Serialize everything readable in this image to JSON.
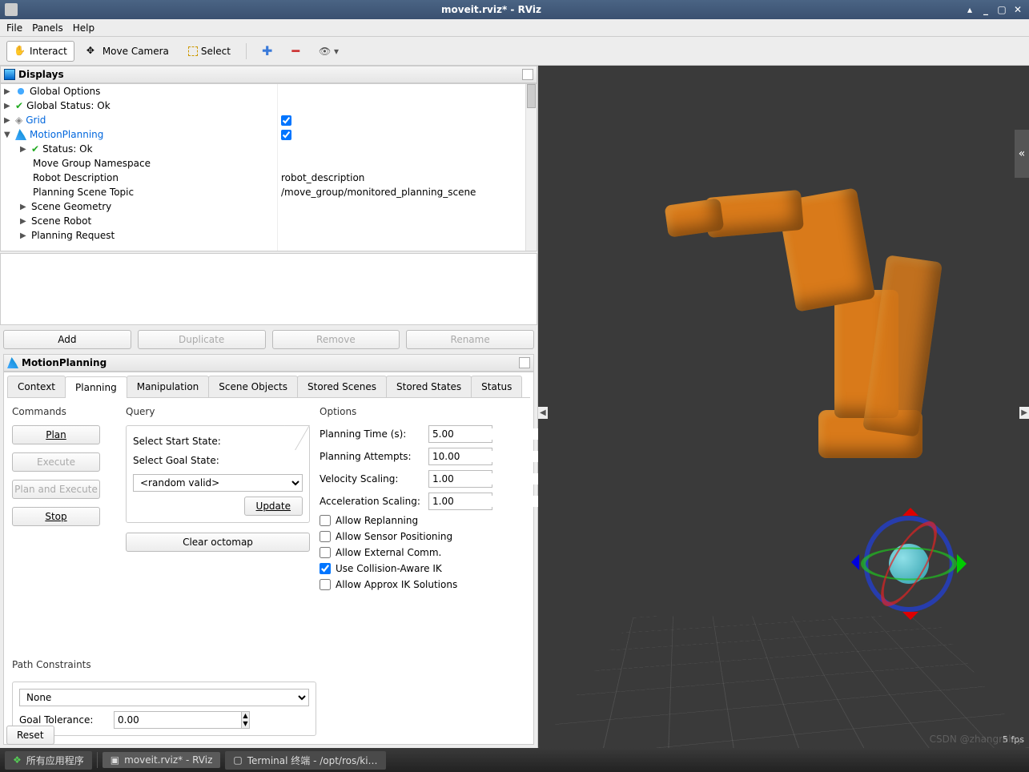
{
  "window": {
    "title": "moveit.rviz* - RViz",
    "buttons": {
      "shade": "▴",
      "min": "_",
      "max": "▢",
      "close": "✕"
    }
  },
  "menu": {
    "file": "File",
    "panels": "Panels",
    "help": "Help"
  },
  "toolbar": {
    "interact": "Interact",
    "move_camera": "Move Camera",
    "select": "Select"
  },
  "displays": {
    "title": "Displays",
    "items": {
      "global_options": "Global Options",
      "global_status": "Global Status: Ok",
      "grid": "Grid",
      "motion_planning": "MotionPlanning",
      "status_ok": "Status: Ok",
      "move_group_ns": "Move Group Namespace",
      "robot_desc": "Robot Description",
      "robot_desc_val": "robot_description",
      "planning_scene_topic": "Planning Scene Topic",
      "planning_scene_val": "/move_group/monitored_planning_scene",
      "scene_geometry": "Scene Geometry",
      "scene_robot": "Scene Robot",
      "planning_request": "Planning Request"
    },
    "buttons": {
      "add": "Add",
      "duplicate": "Duplicate",
      "remove": "Remove",
      "rename": "Rename"
    }
  },
  "mp_panel": {
    "title": "MotionPlanning",
    "tabs": {
      "context": "Context",
      "planning": "Planning",
      "manipulation": "Manipulation",
      "scene_objects": "Scene Objects",
      "stored_scenes": "Stored Scenes",
      "stored_states": "Stored States",
      "status": "Status"
    },
    "commands": {
      "title": "Commands",
      "plan": "Plan",
      "execute": "Execute",
      "plan_and_execute": "Plan and Execute",
      "stop": "Stop"
    },
    "query": {
      "title": "Query",
      "start_state": "Select Start State:",
      "goal_state": "Select Goal State:",
      "random_valid": "<random valid>",
      "update": "Update",
      "clear_octomap": "Clear octomap"
    },
    "options": {
      "title": "Options",
      "planning_time": "Planning Time (s):",
      "planning_time_val": "5.00",
      "planning_attempts": "Planning Attempts:",
      "planning_attempts_val": "10.00",
      "velocity_scaling": "Velocity Scaling:",
      "velocity_scaling_val": "1.00",
      "accel_scaling": "Acceleration Scaling:",
      "accel_scaling_val": "1.00",
      "allow_replanning": "Allow Replanning",
      "allow_sensor": "Allow Sensor Positioning",
      "allow_external": "Allow External Comm.",
      "use_collision_ik": "Use Collision-Aware IK",
      "allow_approx_ik": "Allow Approx IK Solutions"
    },
    "path": {
      "title": "Path Constraints",
      "none": "None",
      "goal_tolerance": "Goal Tolerance:",
      "goal_tolerance_val": "0.00"
    }
  },
  "reset": "Reset",
  "fps": "5 fps",
  "taskbar": {
    "all_apps": "所有应用程序",
    "rviz": "moveit.rviz* - RViz",
    "terminal": "Terminal 终端 - /opt/ros/ki…"
  },
  "watermark": "CSDN @zhangrelay"
}
